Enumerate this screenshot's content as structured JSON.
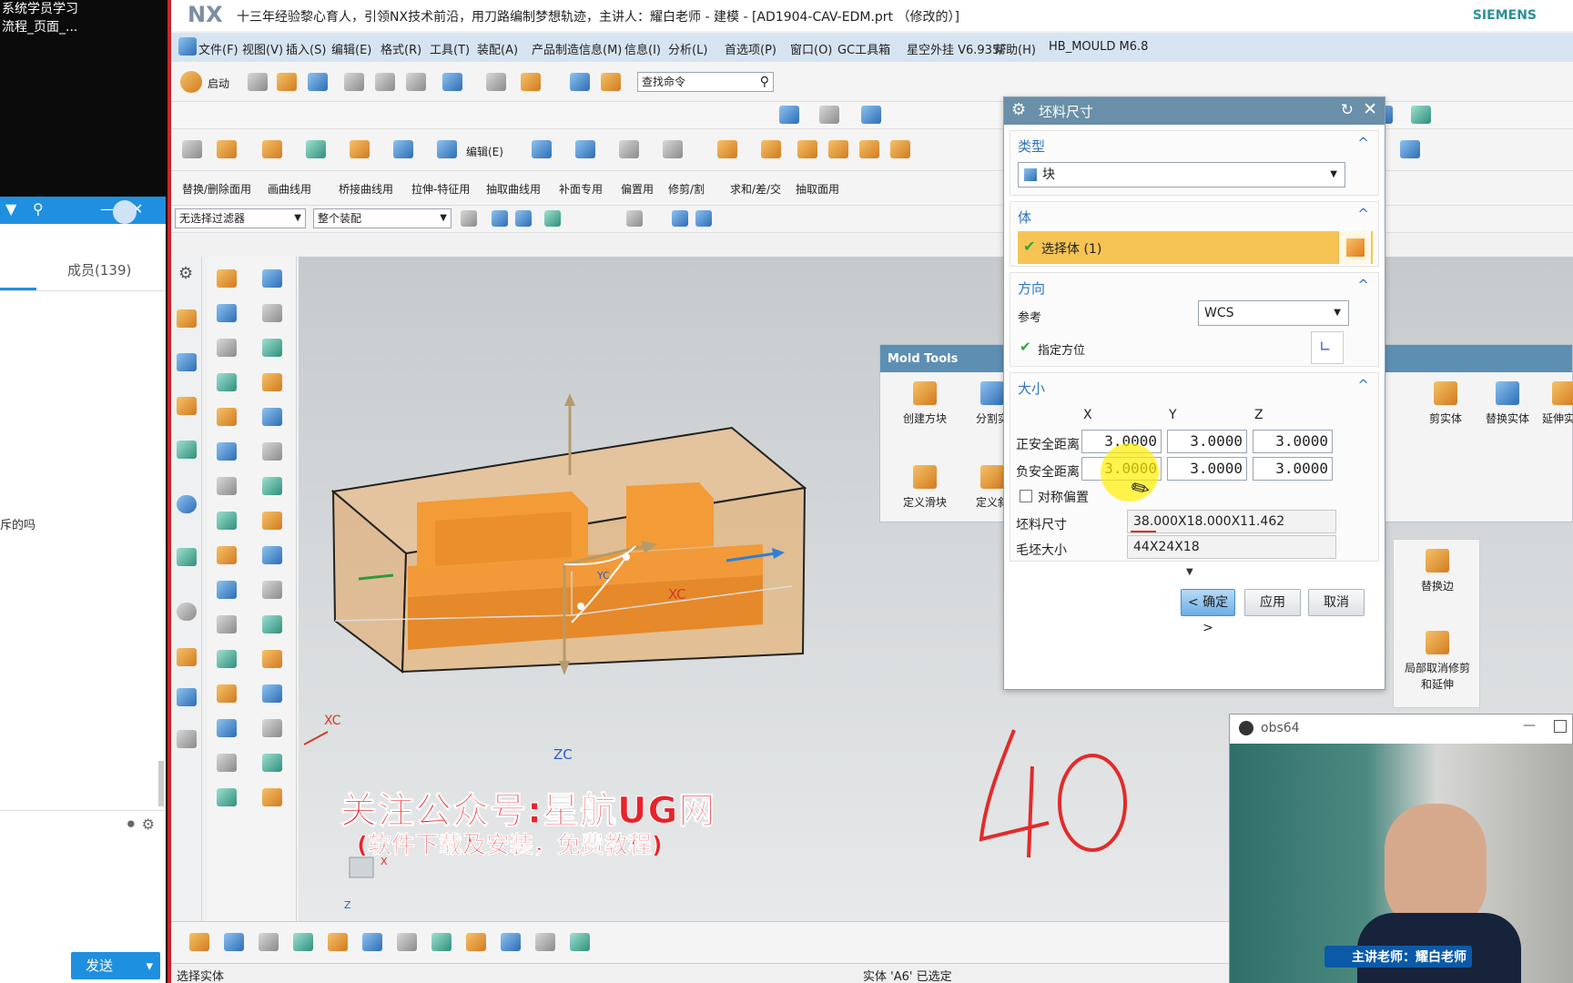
{
  "chat": {
    "top_line1": "系统学员学习",
    "top_line2": "流程_页面_...",
    "bar_icons": {
      "dropdown": "▼",
      "pin": "⚲",
      "minimize": "—",
      "close": "✕"
    },
    "members_tab": "成员(139)",
    "snippet": "斥的吗",
    "send_label": "发送",
    "send_arrow": "▾"
  },
  "nx": {
    "logo": "NX",
    "title": "十三年经验黎心育人，引领NX技术前沿，用刀路编制梦想轨迹，主讲人：耀白老师 - 建模 - [AD1904-CAV-EDM.prt （修改的）]",
    "brand": "SIEMENS",
    "menu": [
      "文件(F)",
      "视图(V)",
      "插入(S)",
      "编辑(E)",
      "格式(R)",
      "工具(T)",
      "装配(A)",
      "产品制造信息(M)",
      "信息(I)",
      "分析(L)",
      "首选项(P)",
      "窗口(O)",
      "GC工具箱",
      "星空外挂 V6.935F",
      "帮助(H)",
      "HB_MOULD M6.8"
    ],
    "toolbar": {
      "start_label": "启动",
      "search_placeholder": "查找命令",
      "edit_label": "编辑(E)",
      "row3": [
        "替换/删除面用",
        "画曲线用",
        "桥接曲线用",
        "拉伸-特征用",
        "抽取曲线用",
        "补面专用",
        "偏置用",
        "修剪/割",
        "求和/差/交",
        "抽取面用"
      ],
      "filter_value": "无选择过滤器",
      "assembly_value": "整个装配"
    },
    "status_left": "选择实体",
    "status_center": "实体 'A6' 已选定",
    "viewport": {
      "xc_label": "XC",
      "zc_label": "ZC",
      "yc_label": "YC",
      "csys_x": "XC",
      "mini_x": "X",
      "mini_z": "Z",
      "handwritten": "40"
    },
    "watermark_main": "关注公众号:星航UG网",
    "watermark_sub": "(软件下载及安装，免费教程)"
  },
  "mold_tools": {
    "title": "Mold Tools",
    "items": [
      "创建方块",
      "分割实",
      "剪实体",
      "替换实体",
      "延伸实体"
    ],
    "items_row2": [
      "定义滑块",
      "定义斜"
    ],
    "side_items": [
      "替换边",
      "局部取消修剪和延伸"
    ]
  },
  "dialog": {
    "title": "坯料尺寸",
    "type_section": "类型",
    "type_value": "块",
    "body_section": "体",
    "select_body": "选择体 (1)",
    "direction_section": "方向",
    "reference_label": "参考",
    "reference_value": "WCS",
    "specify_orientation": "指定方位",
    "size_section": "大小",
    "col_x": "X",
    "col_y": "Y",
    "col_z": "Z",
    "pos_label": "正安全距离",
    "neg_label": "负安全距离",
    "pos_values": [
      "3.0000",
      "3.0000",
      "3.0000"
    ],
    "neg_values": [
      "3.0000",
      "3.0000",
      "3.0000"
    ],
    "symmetric_label": "对称偏置",
    "blank_label": "坯料尺寸",
    "blank_value": "38.000X18.000X11.462",
    "rough_label": "毛坯大小",
    "rough_value": "44X24X18",
    "ok_label": "< 确定 >",
    "apply_label": "应用",
    "cancel_label": "取消"
  },
  "obs": {
    "title": "obs64",
    "teacher_label": "主讲老师：耀白老师"
  },
  "colors": {
    "accent": "#2f74c0",
    "highlight": "#f6c454",
    "brand": "#2c8f99",
    "watermark": "#e8232a"
  }
}
